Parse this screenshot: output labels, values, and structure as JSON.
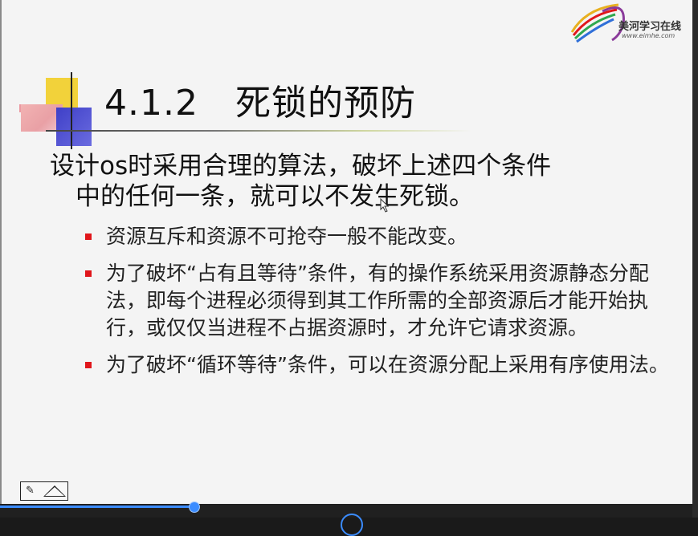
{
  "slide": {
    "title_number": "4.1.2",
    "title_text": "死锁的预防",
    "intro_line1": "设计os时采用合理的算法，破坏上述四个条件",
    "intro_line2": "中的任何一条，就可以不发生死锁。",
    "bullets": [
      "资源互斥和资源不可抢夺一般不能改变。",
      "为了破坏“占有且等待”条件，有的操作系统采用资源静态分配法，即每个进程必须得到其工作所需的全部资源后才能开始执行，或仅仅当进程不占据资源时，才允许它请求资源。",
      "为了破坏“循环等待”条件，可以在资源分配上采用有序使用法。"
    ],
    "bullet_color": "#e0161b"
  },
  "logo": {
    "name": "美河学习在线",
    "url": "www.eimhe.com"
  },
  "player": {
    "progress_percent": 28,
    "accent": "#3b8cff"
  },
  "nav": {
    "pen_icon": "pen-icon",
    "up_icon": "triangle-up-icon"
  }
}
